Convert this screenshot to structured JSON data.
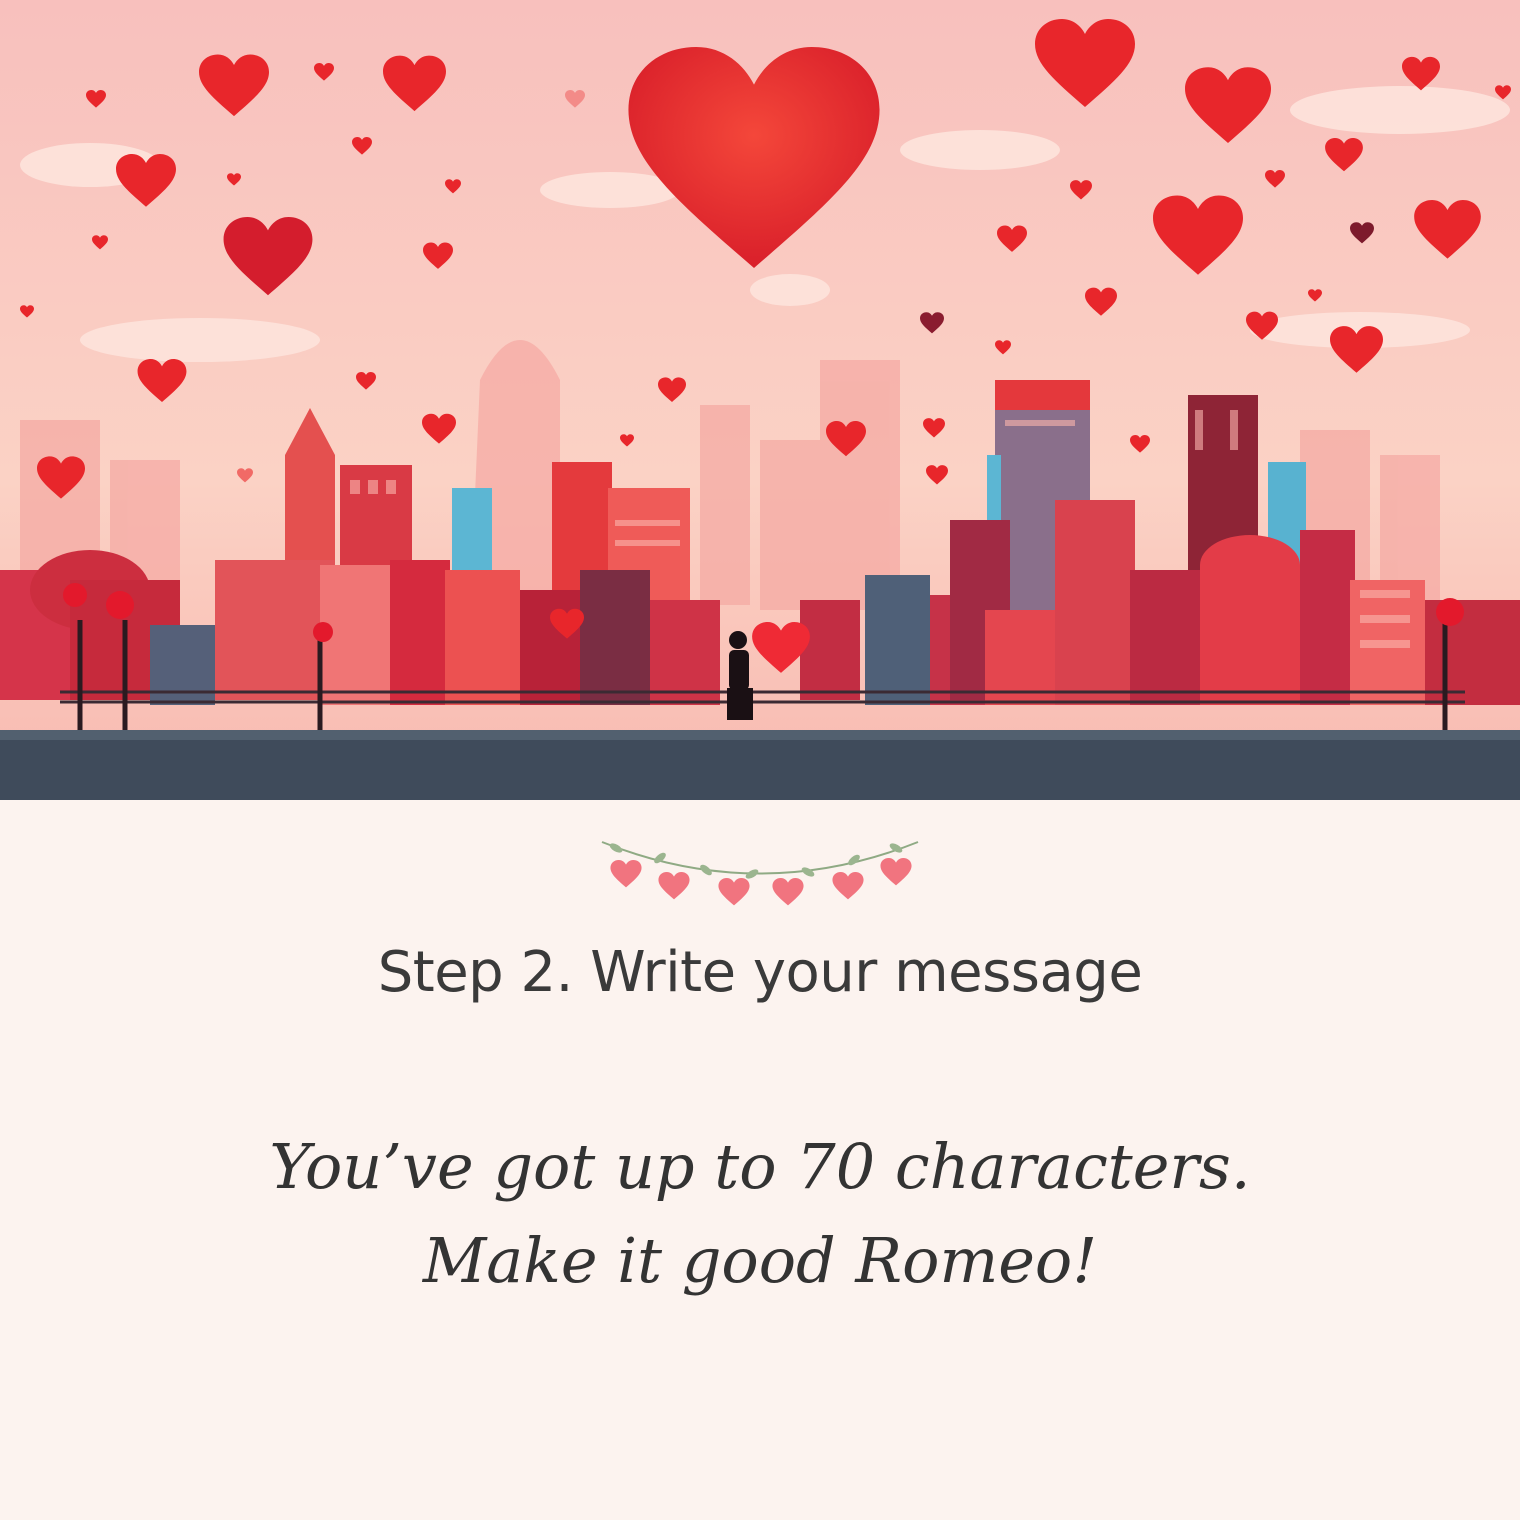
{
  "hero": {
    "scene": "valentine-city-illustration",
    "colors": {
      "sky_top": "#f9c3bf",
      "sky_bottom": "#fbd6c4",
      "heart": "#e8262b",
      "heart_dark": "#b8152a",
      "street": "#3d4a5a"
    }
  },
  "decoration": {
    "icon": "heart-garland-icon",
    "heart_color": "#f1747f",
    "leaf_color": "#9bb58f"
  },
  "step": {
    "title": "Step 2. Write your message"
  },
  "hint": {
    "line1": "You’ve got up to 70 characters.",
    "line2": "Make it good Romeo!"
  }
}
